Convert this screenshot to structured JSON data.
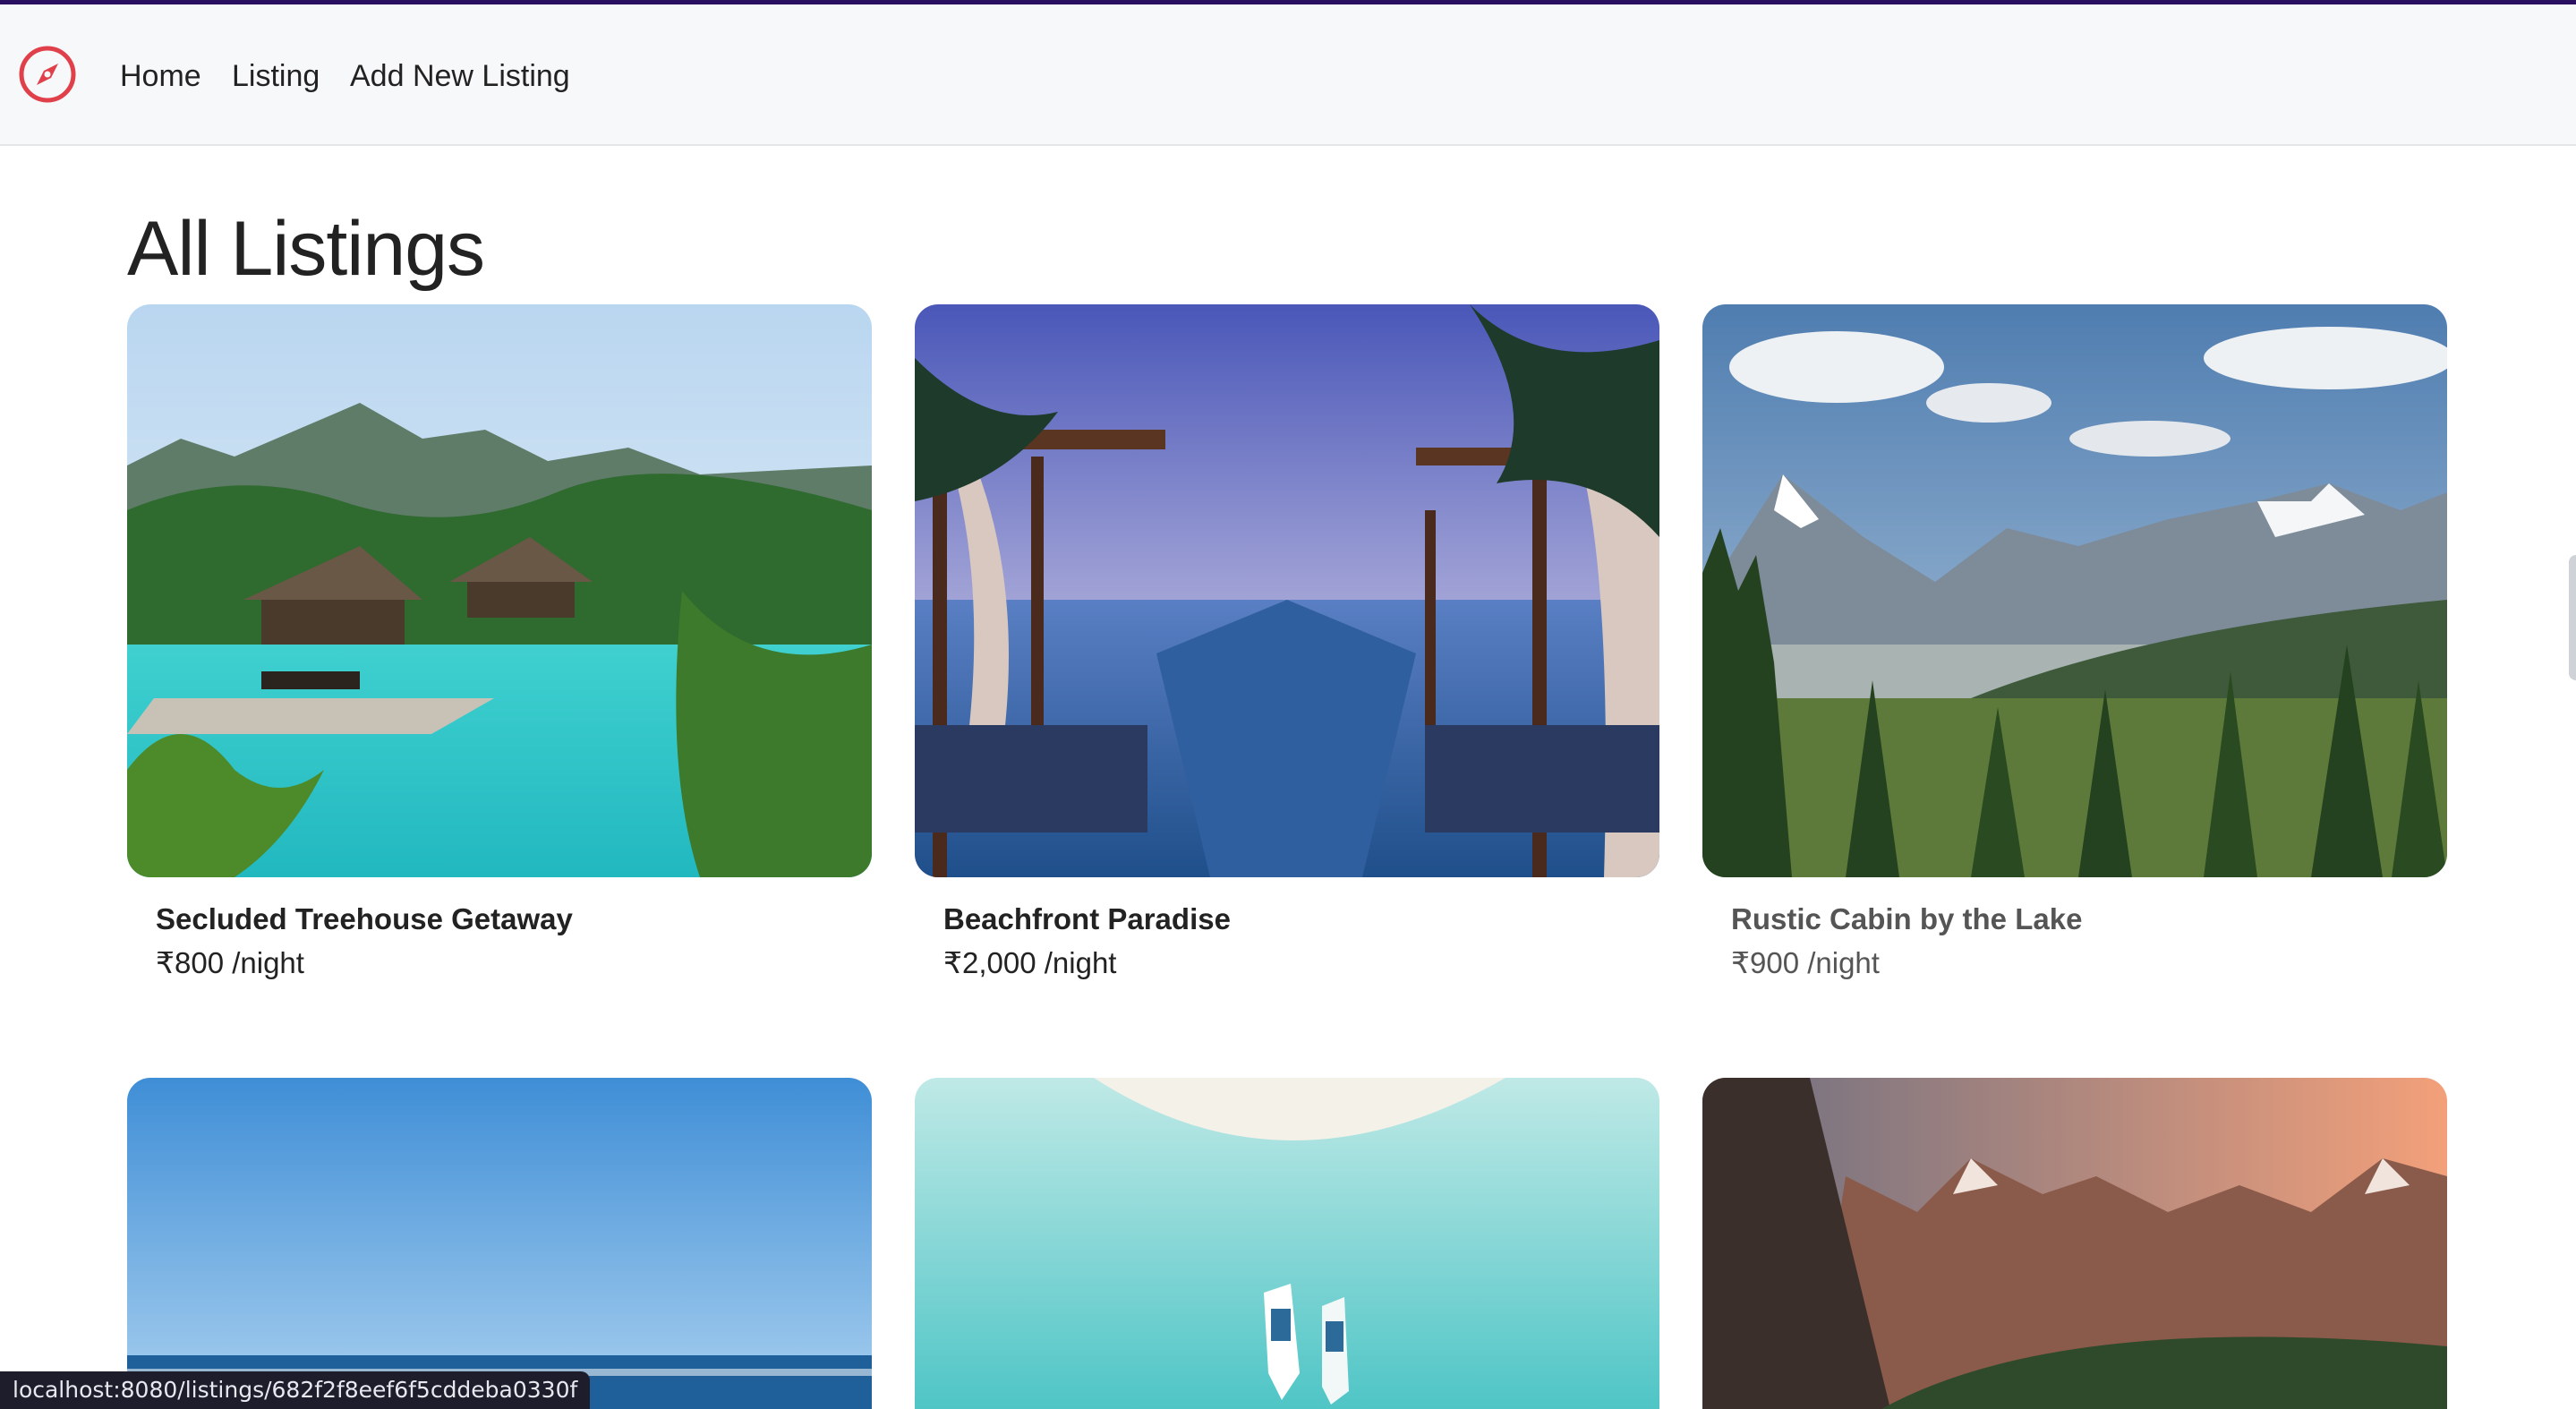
{
  "nav": {
    "logo_icon": "compass-icon",
    "accent_color": "#e0404a",
    "links": [
      {
        "label": "Home"
      },
      {
        "label": "Listing"
      },
      {
        "label": "Add New Listing"
      }
    ]
  },
  "page": {
    "title": "All Listings"
  },
  "listings": [
    {
      "title": "Secluded Treehouse Getaway",
      "price": "₹800 /night"
    },
    {
      "title": "Beachfront Paradise",
      "price": "₹2,000 /night"
    },
    {
      "title": "Rustic Cabin by the Lake",
      "price": "₹900 /night"
    },
    {
      "title": "",
      "price": ""
    },
    {
      "title": "",
      "price": ""
    },
    {
      "title": "",
      "price": ""
    }
  ],
  "status_bar": {
    "url": "localhost:8080/listings/682f2f8eef6f5cddeba0330f"
  }
}
